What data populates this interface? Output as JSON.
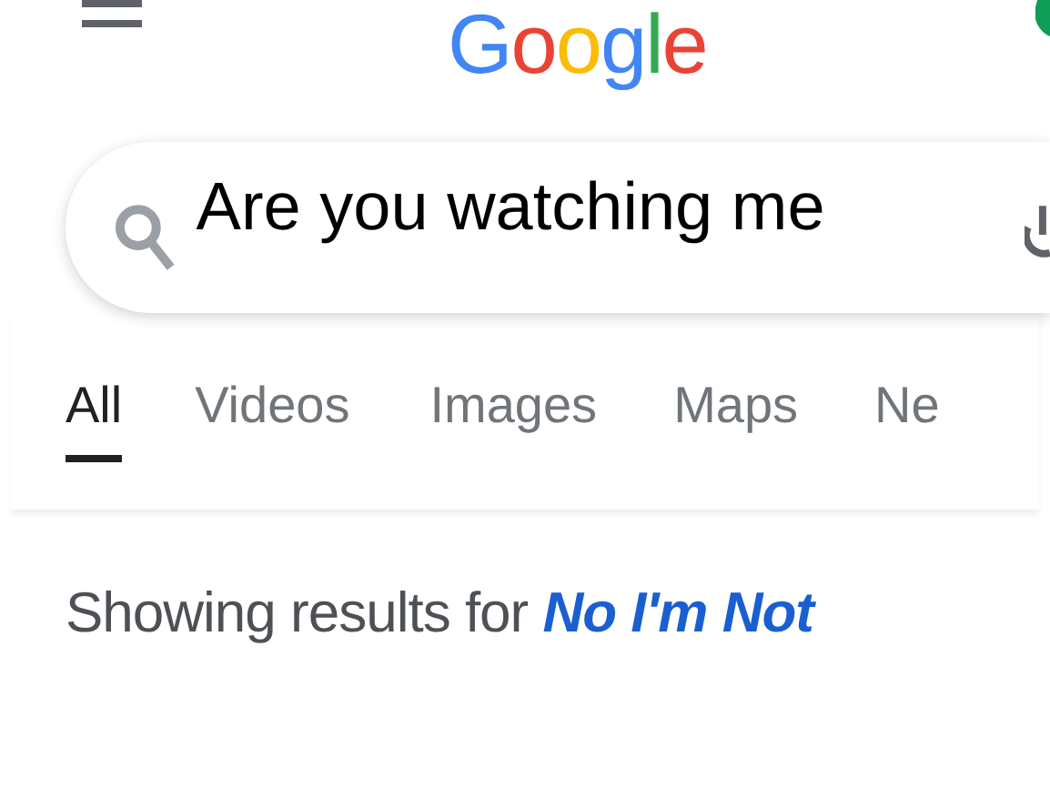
{
  "header": {
    "logo": "Google"
  },
  "search": {
    "value": "Are you watching me"
  },
  "tabs": [
    {
      "label": "All",
      "selected": true
    },
    {
      "label": "Videos",
      "selected": false
    },
    {
      "label": "Images",
      "selected": false
    },
    {
      "label": "Maps",
      "selected": false
    },
    {
      "label": "Ne",
      "selected": false
    }
  ],
  "spelling_notice": {
    "text": "Showing results for",
    "link": "No I'm Not"
  }
}
